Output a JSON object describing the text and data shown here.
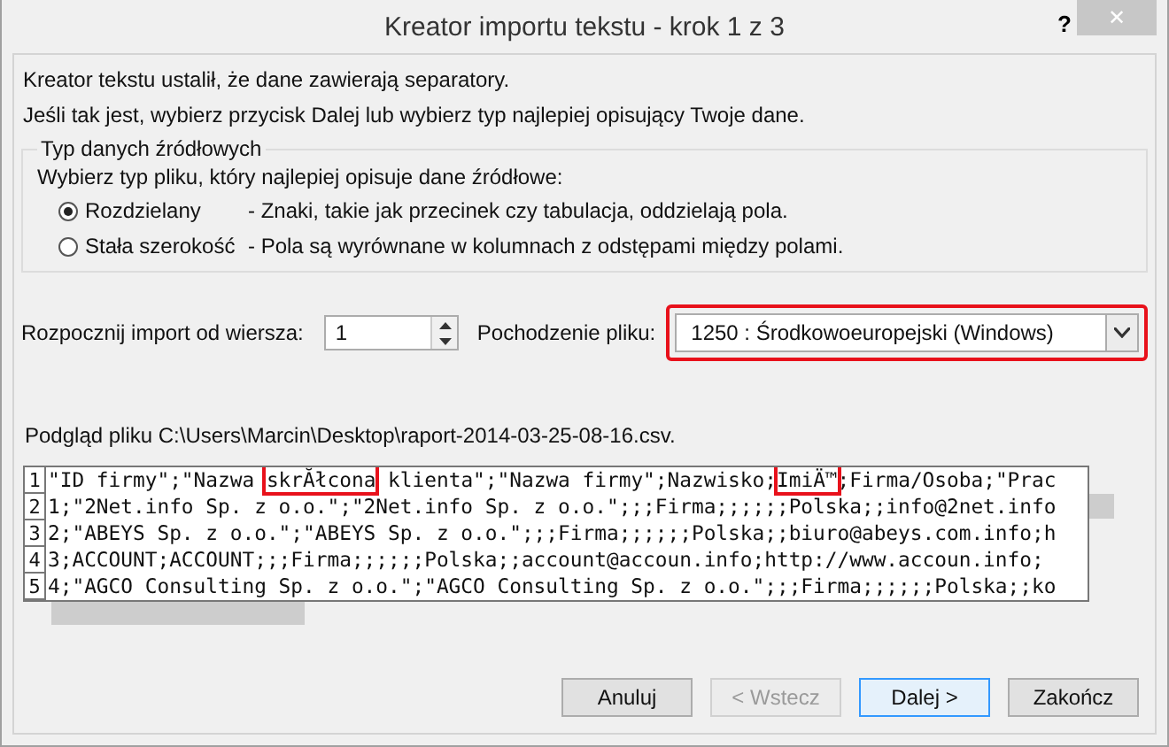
{
  "window": {
    "title": "Kreator importu tekstu - krok 1 z 3",
    "help": "?",
    "close": "✕"
  },
  "intro": [
    "Kreator tekstu ustalił, że dane zawierają separatory.",
    "Jeśli tak jest, wybierz przycisk Dalej lub wybierz typ najlepiej opisujący Twoje dane."
  ],
  "source_type": {
    "legend": "Typ danych źródłowych",
    "prompt": "Wybierz typ pliku, który najlepiej opisuje dane źródłowe:",
    "options": [
      {
        "label": "Rozdzielany",
        "description": "- Znaki, takie jak przecinek czy tabulacja, oddzielają pola.",
        "selected": true
      },
      {
        "label": "Stała szerokość",
        "description": "- Pola są wyrównane w kolumnach z odstępami między polami.",
        "selected": false
      }
    ]
  },
  "start_row": {
    "label": "Rozpocznij import od wiersza:",
    "value": "1"
  },
  "origin": {
    "label": "Pochodzenie pliku:",
    "value": "1250 : Środkowoeuropejski (Windows)",
    "highlighted": true
  },
  "preview": {
    "label": "Podgląd pliku C:\\Users\\Marcin\\Desktop\\raport-2014-03-25-08-16.csv.",
    "lines": [
      {
        "number": "1",
        "segments": [
          {
            "text": "\"ID firmy\";\"Nazwa ",
            "highlighted": false
          },
          {
            "text": "skrĂłcona",
            "highlighted": true
          },
          {
            "text": " klienta\";\"Nazwa firmy\";Nazwisko;",
            "highlighted": false
          },
          {
            "text": "ImiÄ™",
            "highlighted": true
          },
          {
            "text": ";Firma/Osoba;\"Prac",
            "highlighted": false
          }
        ]
      },
      {
        "number": "2",
        "segments": [
          {
            "text": "1;\"2Net.info Sp. z o.o.\";\"2Net.info Sp. z o.o.\";;;Firma;;;;;;Polska;;info@2net.info",
            "highlighted": false
          }
        ]
      },
      {
        "number": "3",
        "segments": [
          {
            "text": "2;\"ABEYS Sp. z o.o.\";\"ABEYS Sp. z o.o.\";;;Firma;;;;;;Polska;;biuro@abeys.com.info;h",
            "highlighted": false
          }
        ]
      },
      {
        "number": "4",
        "segments": [
          {
            "text": "3;ACCOUNT;ACCOUNT;;;Firma;;;;;;Polska;;account@accoun.info;http://www.accoun.info;",
            "highlighted": false
          }
        ]
      },
      {
        "number": "5",
        "segments": [
          {
            "text": "4;\"AGCO Consulting Sp. z o.o.\";\"AGCO Consulting Sp. z o.o.\";;;Firma;;;;;;Polska;;ko",
            "highlighted": false
          }
        ]
      }
    ]
  },
  "buttons": [
    {
      "label": "Anuluj",
      "disabled": false,
      "focused": false
    },
    {
      "label": "< Wstecz",
      "disabled": true,
      "focused": false
    },
    {
      "label": "Dalej >",
      "disabled": false,
      "focused": true
    },
    {
      "label": "Zakończ",
      "disabled": false,
      "focused": false
    }
  ]
}
